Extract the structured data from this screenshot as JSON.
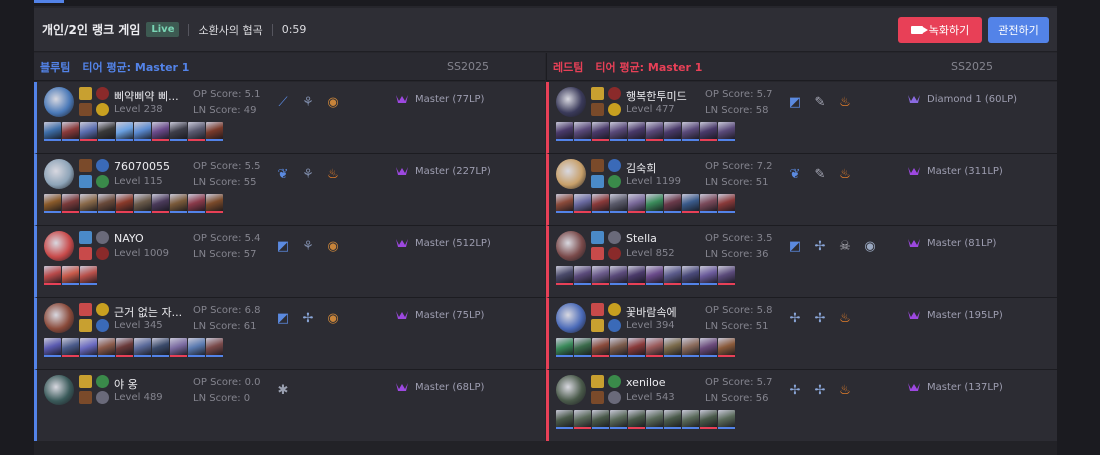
{
  "header": {
    "game_mode": "개인/2인 랭크 게임",
    "live_badge": "Live",
    "map_name": "소환사의 협곡",
    "game_time": "0:59",
    "record_button": "녹화하기",
    "spectate_button": "관전하기"
  },
  "teams": {
    "blue": {
      "label": "블루팀",
      "tier_avg": "티어 평균: Master 1",
      "season": "SS2025",
      "color": "#5383e8"
    },
    "red": {
      "label": "레드팀",
      "tier_avg": "티어 평균: Master 1",
      "season": "SS2025",
      "color": "#e84057"
    }
  },
  "colors": {
    "win": "#5383e8",
    "loss": "#e84057",
    "accent_blue": "#5383e8",
    "accent_red": "#e84057",
    "panel": "#2c2c33"
  },
  "players": {
    "blue": [
      {
        "name": "삐약삐약 삐...",
        "level": "Level 238",
        "op_score": "OP Score: 5.1",
        "ln_score": "LN Score: 49",
        "rank": "Master (77LP)",
        "champ_color": "#4a79b8",
        "badges": [
          "slash-badge-icon",
          "lotus-badge-icon",
          "bronze-medal-icon"
        ],
        "history": [
          "#3e6ea8",
          "#8a3a3a",
          "#5b6eb0",
          "#3a3a3a",
          "#6aa0e0",
          "#5a8ad0",
          "#6a4a8a",
          "#3e3e4a",
          "#5a5a70",
          "#7a3a2a"
        ],
        "results": [
          "win",
          "win",
          "loss",
          "win",
          "win",
          "win",
          "loss",
          "win",
          "loss",
          "win"
        ]
      },
      {
        "name": "76070055",
        "level": "Level 115",
        "op_score": "OP Score: 5.5",
        "ln_score": "LN Score: 55",
        "rank": "Master (227LP)",
        "champ_color": "#8ea4b8",
        "badges": [
          "plant-badge-icon",
          "lotus-badge-icon",
          "flame-badge-icon"
        ],
        "history": [
          "#8a5a2a",
          "#7a3a3a",
          "#8a6a4a",
          "#6a4a3a",
          "#8a3a2a",
          "#6a5a4a",
          "#4a3a5a",
          "#7a5a3a",
          "#8a3a4a",
          "#7a4a2a"
        ],
        "results": [
          "win",
          "loss",
          "win",
          "win",
          "loss",
          "win",
          "loss",
          "win",
          "win",
          "loss"
        ]
      },
      {
        "name": "NAYO",
        "level": "Level 1009",
        "op_score": "OP Score: 5.4",
        "ln_score": "LN Score: 57",
        "rank": "Master (512LP)",
        "champ_color": "#c84a4a",
        "badges": [
          "frame-badge-icon",
          "lotus-badge-icon",
          "bronze-medal-icon"
        ],
        "history": [
          "#b84a4a",
          "#c85a4a",
          "#b8504a"
        ],
        "results": [
          "loss",
          "win",
          "win"
        ]
      },
      {
        "name": "근거 없는 자...",
        "level": "Level 345",
        "op_score": "OP Score: 6.8",
        "ln_score": "LN Score: 61",
        "rank": "Master (75LP)",
        "champ_color": "#8a4a3a",
        "badges": [
          "frame-badge-icon",
          "wings-badge-icon",
          "bronze-medal-icon"
        ],
        "history": [
          "#5a5ab0",
          "#4a5a8a",
          "#6a6ac0",
          "#8a5a4a",
          "#6a3a3a",
          "#5a6a9a",
          "#3a4a6a",
          "#7a6aa0",
          "#5a7ab0",
          "#7a4a4a"
        ],
        "results": [
          "win",
          "loss",
          "win",
          "win",
          "loss",
          "win",
          "win",
          "loss",
          "win",
          "win"
        ]
      },
      {
        "name": "야 옹",
        "level": "Level 489",
        "op_score": "OP Score: 0.0",
        "ln_score": "LN Score: 0",
        "rank": "Master (68LP)",
        "champ_color": "#3a5a5a",
        "badges": [
          "asterisk-badge-icon"
        ],
        "history": [],
        "results": []
      }
    ],
    "red": [
      {
        "name": "행복한투미드",
        "level": "Level 477",
        "op_score": "OP Score: 5.7",
        "ln_score": "LN Score: 58",
        "rank": "Diamond 1 (60LP)",
        "champ_color": "#3a3a5a",
        "badges": [
          "frame-badge-icon",
          "megaphone-badge-icon",
          "flame-badge-icon"
        ],
        "history": [
          "#4a3a6a",
          "#5a4a7a",
          "#4a3a6a",
          "#5a4a7a",
          "#4a3a6a",
          "#5a4a7a",
          "#4a3a6a",
          "#5a4a7a",
          "#4a3a6a",
          "#5a4a7a"
        ],
        "results": [
          "win",
          "win",
          "loss",
          "win",
          "win",
          "loss",
          "win",
          "win",
          "loss",
          "win"
        ]
      },
      {
        "name": "김숙희",
        "level": "Level 1199",
        "op_score": "OP Score: 7.2",
        "ln_score": "LN Score: 51",
        "rank": "Master (311LP)",
        "champ_color": "#c8a06a",
        "badges": [
          "plant-badge-icon",
          "megaphone-badge-icon",
          "flame-badge-icon"
        ],
        "history": [
          "#8a4a3a",
          "#6a6aa0",
          "#8a3a3a",
          "#5a5a6a",
          "#7a6a9a",
          "#3a8a5a",
          "#6a3a4a",
          "#3a5a8a",
          "#7a4a5a",
          "#8a3a3a"
        ],
        "results": [
          "win",
          "loss",
          "win",
          "win",
          "loss",
          "win",
          "win",
          "loss",
          "win",
          "win"
        ]
      },
      {
        "name": "Stella",
        "level": "Level 852",
        "op_score": "OP Score: 3.5",
        "ln_score": "LN Score: 36",
        "rank": "Master (81LP)",
        "champ_color": "#7a4a4a",
        "badges": [
          "frame-badge-icon",
          "wings-badge-icon",
          "skull-badge-icon",
          "silver-medal-icon"
        ],
        "history": [
          "#4a4a6a",
          "#5a4a7a",
          "#6a5a8a",
          "#5a4a7a",
          "#4a3a6a",
          "#6a4a8a",
          "#5a5a8a",
          "#4a4a7a",
          "#6a5a9a",
          "#5a4a7a"
        ],
        "results": [
          "loss",
          "win",
          "loss",
          "win",
          "loss",
          "win",
          "loss",
          "win",
          "win",
          "loss"
        ]
      },
      {
        "name": "꽃바람속에",
        "level": "Level 394",
        "op_score": "OP Score: 5.8",
        "ln_score": "LN Score: 51",
        "rank": "Master (195LP)",
        "champ_color": "#4a6ab8",
        "badges": [
          "wings-badge-icon",
          "wings-badge-icon",
          "flame-badge-icon"
        ],
        "history": [
          "#3a8a5a",
          "#3a6a4a",
          "#8a4a3a",
          "#7a5a4a",
          "#8a3a3a",
          "#9a5a5a",
          "#7a6a4a",
          "#8a6a5a",
          "#6a4a7a",
          "#8a5a3a"
        ],
        "results": [
          "win",
          "win",
          "loss",
          "win",
          "win",
          "loss",
          "win",
          "win",
          "win",
          "loss"
        ]
      },
      {
        "name": "xeniloe",
        "level": "Level 543",
        "op_score": "OP Score: 5.7",
        "ln_score": "LN Score: 56",
        "rank": "Master (137LP)",
        "champ_color": "#4a5a4a",
        "badges": [
          "wings-badge-icon",
          "wings-badge-icon",
          "flame-badge-icon"
        ],
        "history": [
          "#4a5a4a",
          "#5a6a5a",
          "#4a5a4a",
          "#5a6a5a",
          "#4a5a4a",
          "#5a6a5a",
          "#4a5a4a",
          "#5a6a5a",
          "#4a5a4a",
          "#5a6a5a"
        ],
        "results": [
          "win",
          "loss",
          "win",
          "win",
          "loss",
          "win",
          "win",
          "win",
          "loss",
          "win"
        ]
      }
    ]
  }
}
